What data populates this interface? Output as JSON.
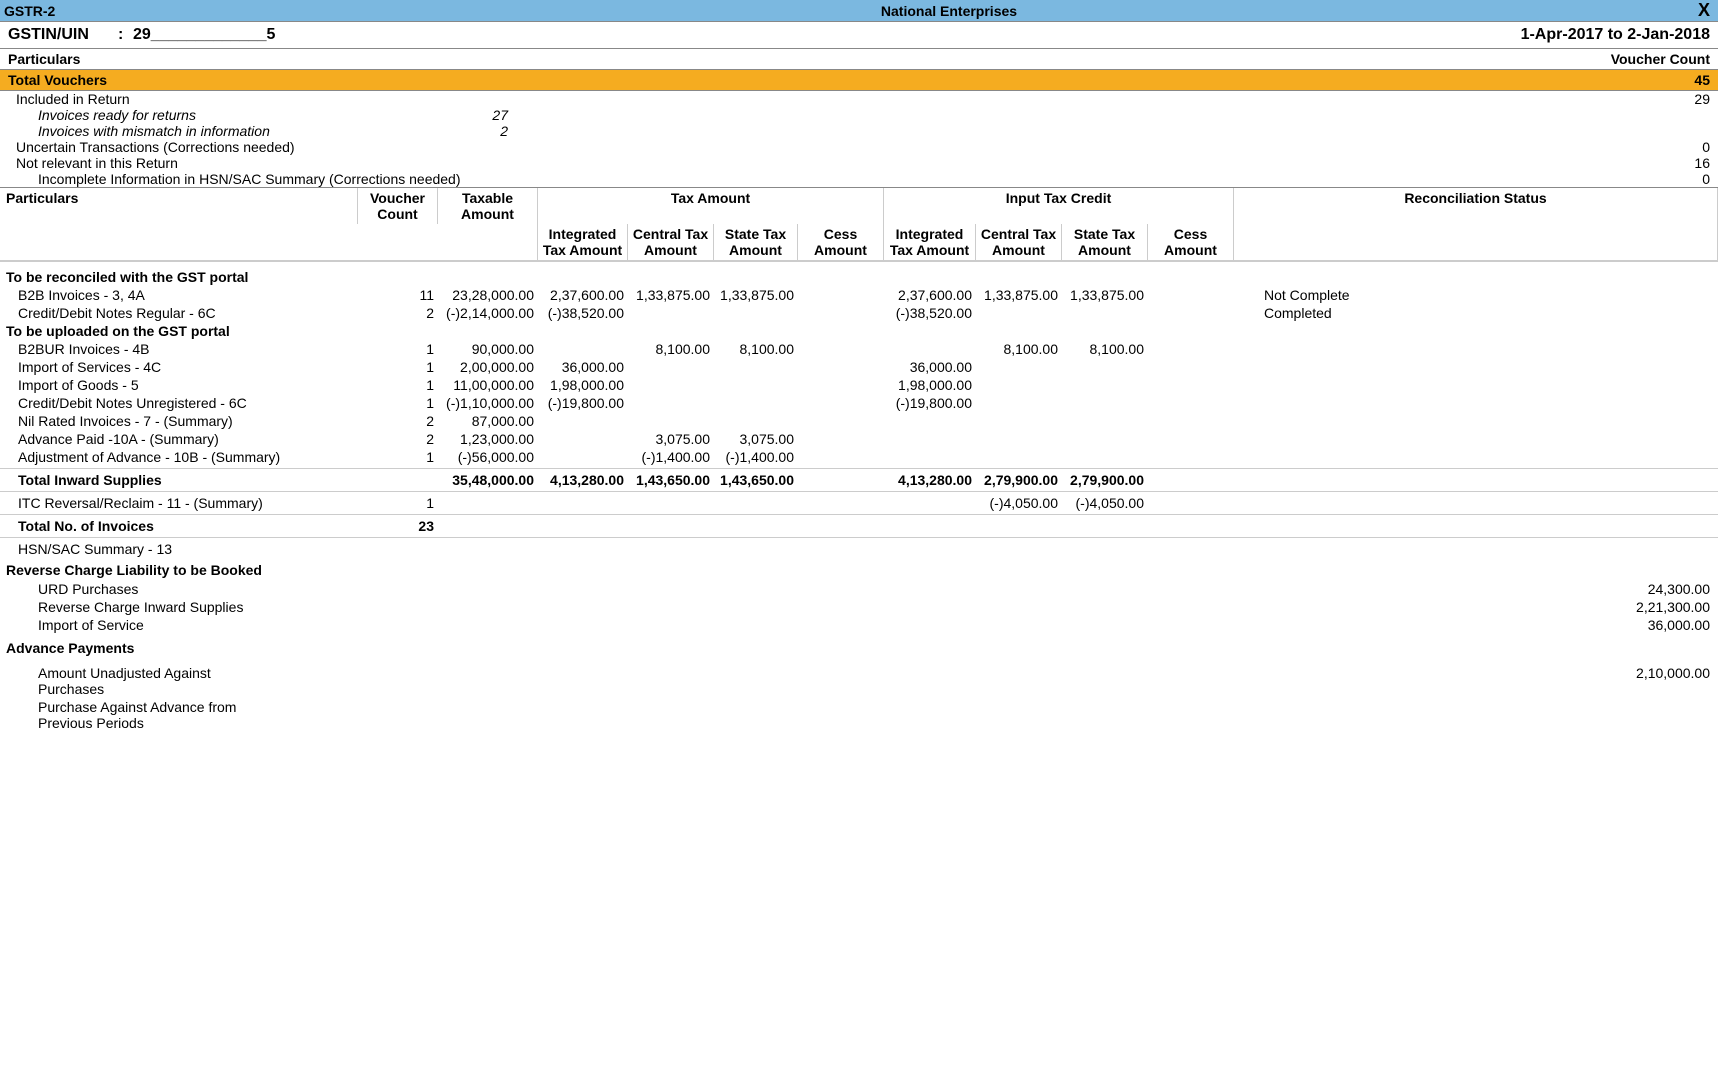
{
  "titlebar": {
    "left": "GSTR-2",
    "center": "National Enterprises",
    "close": "X"
  },
  "header": {
    "gstin_label": "GSTIN/UIN",
    "gstin_colon": ":",
    "gstin_value": "29_____________5",
    "period": "1-Apr-2017 to 2-Jan-2018"
  },
  "summary_hdr": {
    "left": "Particulars",
    "right": "Voucher Count"
  },
  "total": {
    "label": "Total Vouchers",
    "count": "45"
  },
  "summary": {
    "included": {
      "label": "Included in Return",
      "count": "29"
    },
    "ready": {
      "label": "Invoices ready for returns",
      "subcount": "27"
    },
    "mismatch": {
      "label": "Invoices with mismatch in information",
      "subcount": "2"
    },
    "uncertain": {
      "label": "Uncertain Transactions (Corrections needed)",
      "count": "0"
    },
    "notrelevant": {
      "label": "Not relevant in this Return",
      "count": "16"
    },
    "incomplete": {
      "label": "Incomplete Information in HSN/SAC Summary (Corrections needed)",
      "count": "0"
    }
  },
  "grid_headers": {
    "particulars": "Particulars",
    "vc": "Voucher Count",
    "taxable": "Taxable Amount",
    "tax_amount": "Tax Amount",
    "itc": "Input Tax Credit",
    "recon": "Reconciliation Status",
    "int": "Integrated Tax Amount",
    "cen": "Central Tax Amount",
    "state": "State Tax Amount",
    "cess": "Cess Amount"
  },
  "groups": {
    "reconciled_label": "To be reconciled with the GST portal",
    "uploaded_label": "To be uploaded on the GST portal"
  },
  "rows": {
    "b2b": {
      "label": "B2B Invoices - 3, 4A",
      "vc": "11",
      "taxable": "23,28,000.00",
      "int": "2,37,600.00",
      "cen": "1,33,875.00",
      "state": "1,33,875.00",
      "iint": "2,37,600.00",
      "icen": "1,33,875.00",
      "istate": "1,33,875.00",
      "recon": "Not Complete"
    },
    "cdnreg": {
      "label": "Credit/Debit Notes Regular - 6C",
      "vc": "2",
      "taxable": "(-)2,14,000.00",
      "int": "(-)38,520.00",
      "iint": "(-)38,520.00",
      "recon": "Completed"
    },
    "b2bur": {
      "label": "B2BUR Invoices - 4B",
      "vc": "1",
      "taxable": "90,000.00",
      "cen": "8,100.00",
      "state": "8,100.00",
      "icen": "8,100.00",
      "istate": "8,100.00"
    },
    "impserv": {
      "label": "Import of Services - 4C",
      "vc": "1",
      "taxable": "2,00,000.00",
      "int": "36,000.00",
      "iint": "36,000.00"
    },
    "impgoods": {
      "label": "Import of Goods - 5",
      "vc": "1",
      "taxable": "11,00,000.00",
      "int": "1,98,000.00",
      "iint": "1,98,000.00"
    },
    "cdnunreg": {
      "label": "Credit/Debit Notes Unregistered - 6C",
      "vc": "1",
      "taxable": "(-)1,10,000.00",
      "int": "(-)19,800.00",
      "iint": "(-)19,800.00"
    },
    "nilrated": {
      "label": "Nil Rated Invoices - 7 - (Summary)",
      "vc": "2",
      "taxable": "87,000.00"
    },
    "advpaid": {
      "label": "Advance Paid -10A - (Summary)",
      "vc": "2",
      "taxable": "1,23,000.00",
      "cen": "3,075.00",
      "state": "3,075.00"
    },
    "advadj": {
      "label": "Adjustment of Advance - 10B - (Summary)",
      "vc": "1",
      "taxable": "(-)56,000.00",
      "cen": "(-)1,400.00",
      "state": "(-)1,400.00"
    },
    "total_inward": {
      "label": "Total Inward Supplies",
      "taxable": "35,48,000.00",
      "int": "4,13,280.00",
      "cen": "1,43,650.00",
      "state": "1,43,650.00",
      "iint": "4,13,280.00",
      "icen": "2,79,900.00",
      "istate": "2,79,900.00"
    },
    "itcrev": {
      "label": "ITC Reversal/Reclaim - 11 - (Summary)",
      "vc": "1",
      "icen": "(-)4,050.00",
      "istate": "(-)4,050.00"
    },
    "totalinv": {
      "label": "Total No. of Invoices",
      "vc": "23"
    },
    "hsn": {
      "label": "HSN/SAC Summary - 13"
    }
  },
  "reverse": {
    "heading": "Reverse Charge Liability to be Booked",
    "urd": {
      "label": "URD Purchases",
      "val": "24,300.00"
    },
    "rcis": {
      "label": "Reverse Charge Inward Supplies",
      "val": "2,21,300.00"
    },
    "imp": {
      "label": "Import of Service",
      "val": "36,000.00"
    }
  },
  "advance": {
    "heading": "Advance Payments",
    "unadj": {
      "label": "Amount Unadjusted Against Purchases",
      "val": "2,10,000.00"
    },
    "prev": {
      "label": "Purchase Against Advance from Previous Periods"
    }
  }
}
